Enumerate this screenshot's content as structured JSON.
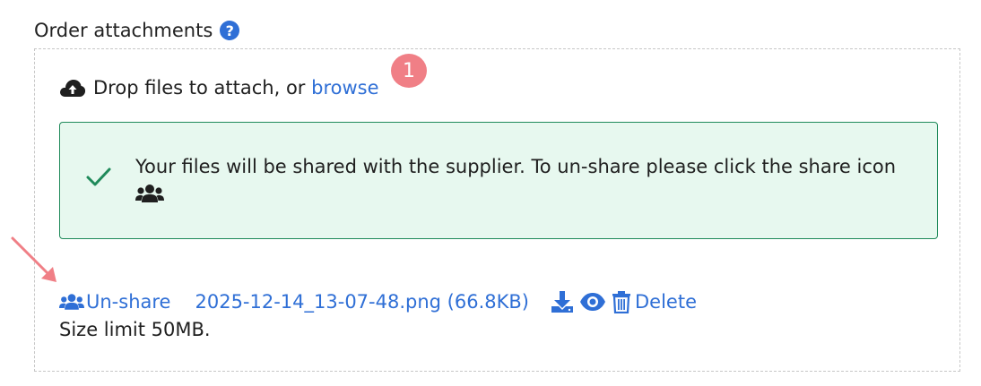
{
  "section": {
    "label": "Order attachments",
    "help_glyph": "?"
  },
  "dropzone": {
    "prefix": "Drop files to attach, or ",
    "browse": "browse",
    "badge": "1"
  },
  "alert": {
    "message": "Your files will be shared with the supplier. To un-share please click the share icon"
  },
  "file": {
    "unshare_label": "Un-share",
    "name": "2025-12-14_13-07-48.png (66.8KB)",
    "delete_label": "Delete"
  },
  "size_limit": "Size limit 50MB.",
  "colors": {
    "link": "#2f6fd6",
    "alert_bg": "#e7f8ef",
    "alert_border": "#1f8a5a",
    "badge": "#f07f86",
    "arrow": "#f07f86"
  }
}
